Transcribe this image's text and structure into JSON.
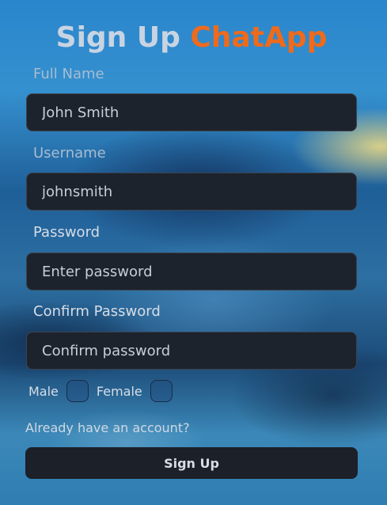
{
  "form": {
    "title_prefix": "Sign Up",
    "title_brand": "ChatApp",
    "fields": {
      "full_name": {
        "label": "Full Name",
        "value": "John Smith"
      },
      "username": {
        "label": "Username",
        "value": "johnsmith"
      },
      "password": {
        "label": "Password",
        "placeholder": "Enter password"
      },
      "confirm_password": {
        "label": "Confirm Password",
        "placeholder": "Confirm password"
      }
    },
    "gender": {
      "male_label": "Male",
      "female_label": "Female"
    },
    "login_link": "Already have an account?",
    "submit_label": "Sign Up"
  },
  "colors": {
    "brand": "#ee6a1c",
    "input_bg": "#1d232c",
    "button_bg": "#1c2029"
  }
}
